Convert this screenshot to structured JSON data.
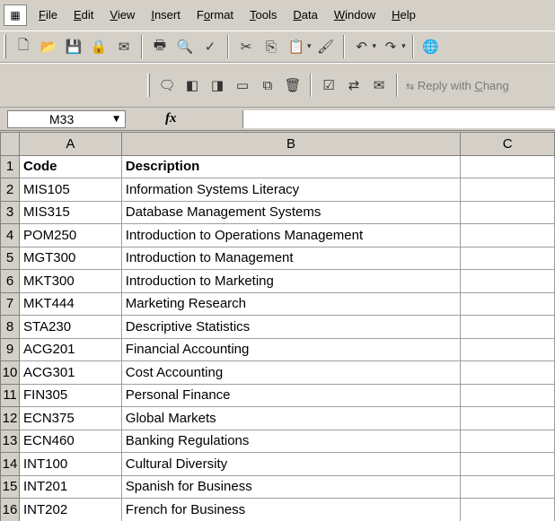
{
  "menu": {
    "app_icon": "excel-doc-icon",
    "items": [
      {
        "id": "file",
        "label": "File",
        "mnemonic": "F",
        "rest": "ile"
      },
      {
        "id": "edit",
        "label": "Edit",
        "mnemonic": "E",
        "rest": "dit"
      },
      {
        "id": "view",
        "label": "View",
        "mnemonic": "V",
        "rest": "iew"
      },
      {
        "id": "insert",
        "label": "Insert",
        "mnemonic": "I",
        "rest": "nsert"
      },
      {
        "id": "format",
        "label": "Format",
        "pre": "F",
        "mnemonic": "o",
        "rest": "rmat"
      },
      {
        "id": "tools",
        "label": "Tools",
        "mnemonic": "T",
        "rest": "ools"
      },
      {
        "id": "data",
        "label": "Data",
        "mnemonic": "D",
        "rest": "ata"
      },
      {
        "id": "window",
        "label": "Window",
        "mnemonic": "W",
        "rest": "indow"
      },
      {
        "id": "help",
        "label": "Help",
        "mnemonic": "H",
        "rest": "elp"
      }
    ]
  },
  "toolbar2": {
    "reply_pre": "Reply with ",
    "reply_mnemonic": "C",
    "reply_rest": "hang"
  },
  "formula_bar": {
    "name_box": "M33",
    "fx_label": "fx",
    "formula": ""
  },
  "grid": {
    "columns": [
      "A",
      "B",
      "C"
    ],
    "rows": [
      {
        "num": "1",
        "a": "Code",
        "b": "Description",
        "bold": true
      },
      {
        "num": "2",
        "a": "MIS105",
        "b": "Information Systems Literacy"
      },
      {
        "num": "3",
        "a": "MIS315",
        "b": "Database Management Systems"
      },
      {
        "num": "4",
        "a": "POM250",
        "b": "Introduction to Operations Management"
      },
      {
        "num": "5",
        "a": "MGT300",
        "b": "Introduction to Management"
      },
      {
        "num": "6",
        "a": "MKT300",
        "b": "Introduction to Marketing"
      },
      {
        "num": "7",
        "a": "MKT444",
        "b": "Marketing Research"
      },
      {
        "num": "8",
        "a": "STA230",
        "b": "Descriptive Statistics"
      },
      {
        "num": "9",
        "a": "ACG201",
        "b": "Financial Accounting"
      },
      {
        "num": "10",
        "a": "ACG301",
        "b": "Cost Accounting"
      },
      {
        "num": "11",
        "a": "FIN305",
        "b": "Personal Finance"
      },
      {
        "num": "12",
        "a": "ECN375",
        "b": "Global Markets"
      },
      {
        "num": "13",
        "a": "ECN460",
        "b": "Banking Regulations"
      },
      {
        "num": "14",
        "a": "INT100",
        "b": "Cultural Diversity"
      },
      {
        "num": "15",
        "a": "INT201",
        "b": "Spanish for Business"
      },
      {
        "num": "16",
        "a": "INT202",
        "b": "French for Business"
      }
    ]
  }
}
